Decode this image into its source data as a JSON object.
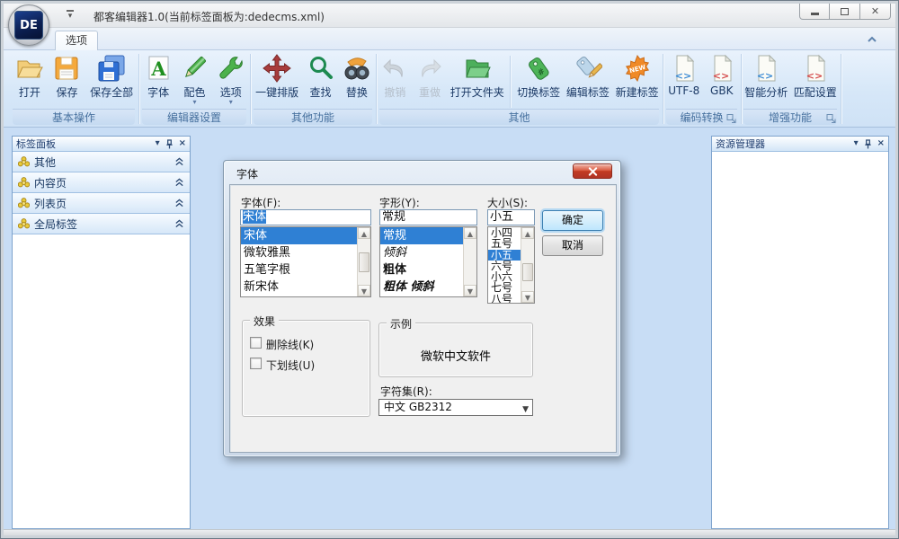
{
  "window": {
    "title": "都客编辑器1.0(当前标签面板为:dedecms.xml)",
    "logo": "DE",
    "controls": {
      "minimize": "minimize",
      "maximize": "maximize",
      "close": "close"
    }
  },
  "colors": {
    "ribbon_bg": "#d6e7f8",
    "workspace_bg": "#c8ddf5",
    "selection_blue": "#2f80d4",
    "close_button_red": "#c23b22",
    "accent_text_navy": "#1c3a66"
  },
  "ribbon": {
    "tab": "选项",
    "groups": [
      {
        "label": "基本操作",
        "buttons": [
          {
            "label": "打开",
            "icon": "open-folder-icon"
          },
          {
            "label": "保存",
            "icon": "save-floppy-icon"
          },
          {
            "label": "保存全部",
            "icon": "save-all-floppy-icon"
          }
        ]
      },
      {
        "label": "编辑器设置",
        "buttons": [
          {
            "label": "字体",
            "icon": "font-letter-icon"
          },
          {
            "label": "配色",
            "icon": "pencil-icon",
            "dropdown": true
          },
          {
            "label": "选项",
            "icon": "wrench-icon",
            "dropdown": true
          }
        ]
      },
      {
        "label": "其他功能",
        "buttons": [
          {
            "label": "一键排版",
            "icon": "move-arrows-icon"
          },
          {
            "label": "查找",
            "icon": "magnifier-icon"
          },
          {
            "label": "替换",
            "icon": "binoculars-icon"
          }
        ]
      },
      {
        "label": "其他",
        "buttons": [
          {
            "label": "撤销",
            "icon": "undo-icon",
            "disabled": true
          },
          {
            "label": "重做",
            "icon": "redo-icon",
            "disabled": true
          },
          {
            "label": "打开文件夹",
            "icon": "green-folder-icon"
          },
          {
            "label": "切换标签",
            "icon": "tag-icon"
          },
          {
            "label": "编辑标签",
            "icon": "tag-edit-icon"
          },
          {
            "label": "新建标签",
            "icon": "new-badge-icon"
          }
        ]
      },
      {
        "label": "编码转换",
        "launcher": true,
        "buttons": [
          {
            "label": "UTF-8",
            "icon": "doc-code-blue-icon"
          },
          {
            "label": "GBK",
            "icon": "doc-code-red-icon"
          }
        ]
      },
      {
        "label": "增强功能",
        "launcher": true,
        "buttons": [
          {
            "label": "智能分析",
            "icon": "doc-code-blue-icon"
          },
          {
            "label": "匹配设置",
            "icon": "doc-code-red-icon"
          }
        ]
      }
    ]
  },
  "left_panel": {
    "title": "标签面板",
    "items": [
      {
        "label": "其他"
      },
      {
        "label": "内容页"
      },
      {
        "label": "列表页"
      },
      {
        "label": "全局标签"
      }
    ]
  },
  "right_panel": {
    "title": "资源管理器"
  },
  "dialog": {
    "title": "字体",
    "font": {
      "label": "字体(F):",
      "value": "宋体",
      "items": [
        "宋体",
        "微软雅黑",
        "五笔字根",
        "新宋体"
      ],
      "selected_index": 0
    },
    "style": {
      "label": "字形(Y):",
      "value": "常规",
      "items": [
        "常规",
        "倾斜",
        "粗体",
        "粗体 倾斜"
      ],
      "selected_index": 0
    },
    "size": {
      "label": "大小(S):",
      "value": "小五",
      "items": [
        "小四",
        "五号",
        "小五",
        "六号",
        "小六",
        "七号",
        "八号"
      ],
      "selected_index": 2
    },
    "ok_label": "确定",
    "cancel_label": "取消",
    "effects": {
      "label": "效果",
      "strikeout_label": "删除线(K)",
      "strikeout_checked": false,
      "underline_label": "下划线(U)",
      "underline_checked": false
    },
    "sample": {
      "label": "示例",
      "text": "微软中文软件"
    },
    "charset": {
      "label": "字符集(R):",
      "value": "中文 GB2312"
    }
  }
}
